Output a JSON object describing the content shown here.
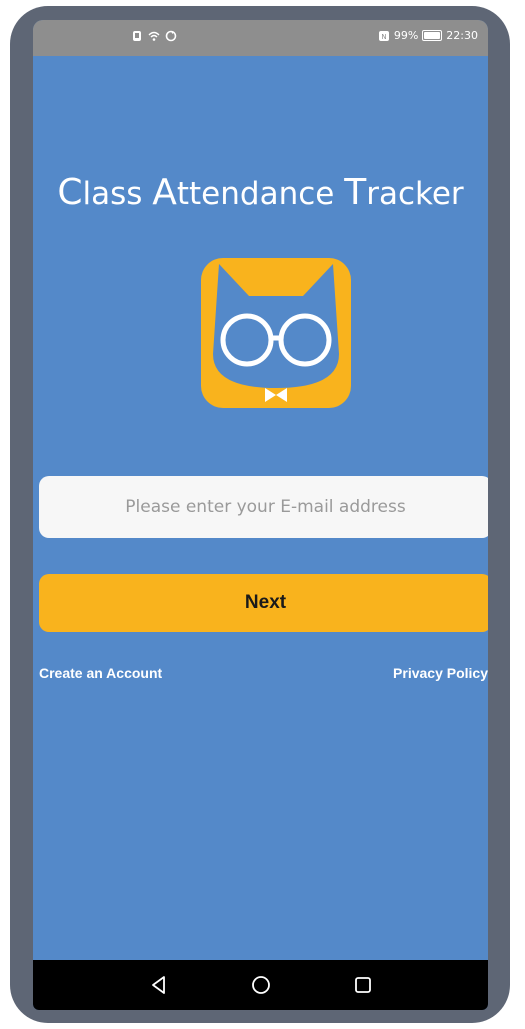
{
  "status_bar": {
    "battery_percent": "99%",
    "battery_level": 0.99,
    "time": "22:30",
    "icons": [
      "notification-icon",
      "wifi-icon",
      "sync-icon",
      "nfc-icon",
      "battery-icon"
    ]
  },
  "app": {
    "title_parts": [
      {
        "initial": "C",
        "rest": "lass "
      },
      {
        "initial": "A",
        "rest": "ttendance "
      },
      {
        "initial": "T",
        "rest": "racker"
      }
    ]
  },
  "logo": {
    "icon": "owl-cat-with-glasses-icon",
    "background_color": "#f9b31d",
    "face_color": "#5489c9"
  },
  "login": {
    "email_placeholder": "Please enter your E-mail address",
    "email_value": "",
    "next_label": "Next",
    "create_account_label": "Create an Account",
    "privacy_policy_label": "Privacy Policy"
  },
  "nav_bar": {
    "back_icon": "back-triangle-icon",
    "home_icon": "home-circle-icon",
    "recents_icon": "recents-square-icon"
  },
  "colors": {
    "background": "#5489c9",
    "accent": "#f9b31d",
    "frame": "#5e6675"
  }
}
